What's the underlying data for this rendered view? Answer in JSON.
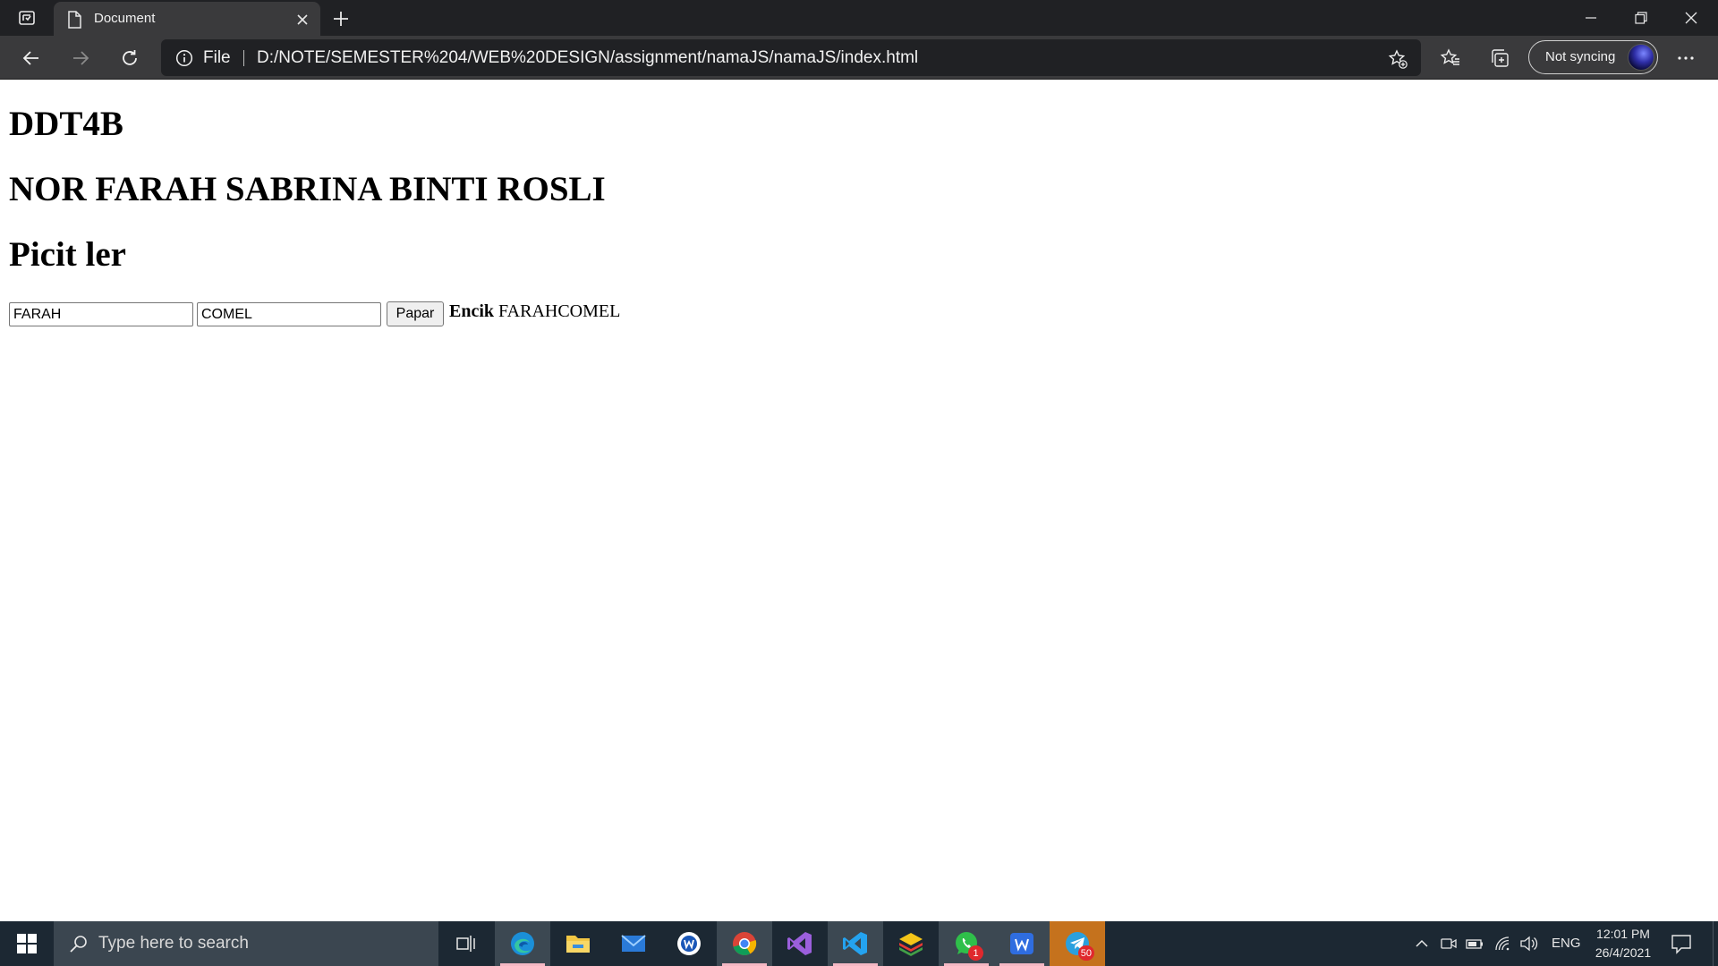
{
  "browser": {
    "tab_title": "Document",
    "address": {
      "scheme_label": "File",
      "url": "D:/NOTE/SEMESTER%204/WEB%20DESIGN/assignment/namaJS/namaJS/index.html"
    },
    "profile_label": "Not syncing"
  },
  "page": {
    "course": "DDT4B",
    "name": "NOR FARAH SABRINA BINTI ROSLI",
    "subtitle": "Picit ler",
    "first_name_value": "FARAH",
    "last_name_value": "COMEL",
    "button_label": "Papar",
    "result_prefix": "Encik",
    "result_value": "FARAHCOMEL"
  },
  "taskbar": {
    "search_placeholder": "Type here to search",
    "apps": [
      {
        "name": "edge",
        "badge": ""
      },
      {
        "name": "file-explorer",
        "badge": ""
      },
      {
        "name": "mail",
        "badge": ""
      },
      {
        "name": "word-app",
        "badge": ""
      },
      {
        "name": "chrome",
        "badge": ""
      },
      {
        "name": "visual-studio",
        "badge": ""
      },
      {
        "name": "vscode",
        "badge": ""
      },
      {
        "name": "bluestacks",
        "badge": ""
      },
      {
        "name": "whatsapp",
        "badge": "1"
      },
      {
        "name": "wps-writer",
        "badge": ""
      },
      {
        "name": "telegram",
        "badge": "50"
      }
    ],
    "language": "ENG",
    "time": "12:01 PM",
    "date": "26/4/2021"
  },
  "colors": {
    "chrome_dark": "#202124",
    "chrome_toolbar": "#3a3a3c",
    "taskbar": "#1c2833",
    "taskbar_search": "#3b4650",
    "active_app_underline": "#f4b8c4",
    "telegram_highlight": "#c5721d",
    "badge": "#e0282d"
  }
}
